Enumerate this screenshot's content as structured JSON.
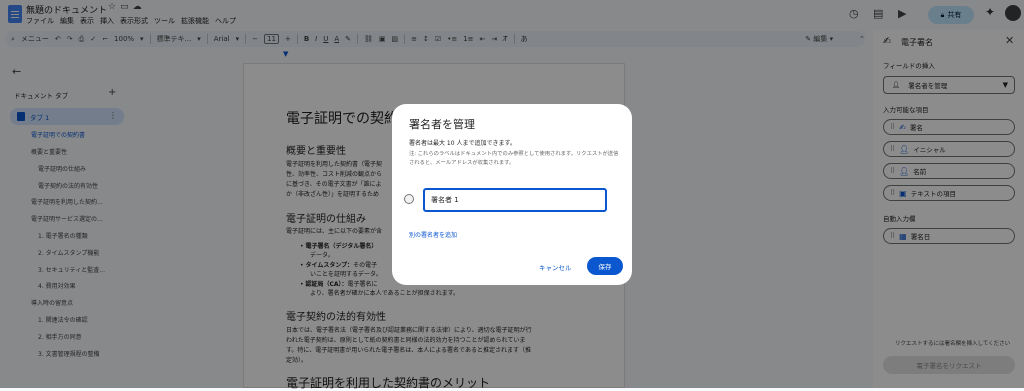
{
  "app": {
    "doc_title": "無題のドキュメント",
    "menus": [
      "ファイル",
      "編集",
      "表示",
      "挿入",
      "表示形式",
      "ツール",
      "拡張機能",
      "ヘルプ"
    ],
    "share_label": "共有"
  },
  "toolbar": {
    "menu_search": "メニュー",
    "zoom": "100%",
    "style": "標準テキ...",
    "font": "Arial",
    "font_size": "11",
    "bold": "B",
    "italic": "I",
    "underline": "U",
    "text_color": "A",
    "edit_mode": "編集"
  },
  "outline": {
    "heading": "ドキュメント タブ",
    "tab_label": "タブ 1",
    "items": [
      {
        "label": "電子証明での契約書",
        "active": true
      },
      {
        "label": "概要と重要性"
      },
      {
        "label": "電子証明の仕組み"
      },
      {
        "label": "電子契約の法的有効性"
      },
      {
        "label": "電子証明を利用した契約..."
      },
      {
        "label": "電子証明サービス選定の..."
      },
      {
        "label": "1. 電子署名の種類"
      },
      {
        "label": "2. タイムスタンプ機能"
      },
      {
        "label": "3. セキュリティと監査..."
      },
      {
        "label": "4. 費用対効果"
      },
      {
        "label": "導入時の留意点"
      },
      {
        "label": "1. 関連法令の確認"
      },
      {
        "label": "2. 相手方の同意"
      },
      {
        "label": "3. 文書管理規程の整備"
      }
    ]
  },
  "document": {
    "title": "電子証明での契約書",
    "section1_heading": "概要と重要性",
    "section1_lines": [
      "電子証明を利用した契約書（電子契",
      "性、効率性、コスト削減の観点から",
      "に基づき、その電子文書が「誰によ",
      "か（非改ざん性）」を証明するため"
    ],
    "section2_heading": "電子証明の仕組み",
    "section2_intro": "電子証明には、主に以下の要素が含",
    "bullets": [
      {
        "bold": "電子署名（デジタル署名）",
        "text": "",
        "cont": "データ。"
      },
      {
        "bold": "タイムスタンプ：",
        "text": "その電子",
        "cont": "いことを証明するデータ。"
      },
      {
        "bold": "認証局（CA）：",
        "text": "電子署名に",
        "cont": "より、署名者が確かに本人であることが担保されます。"
      }
    ],
    "section3_heading": "電子契約の法的有効性",
    "section3_lines": [
      "日本では、電子署名法（電子署名及び認証業務に関する法律）により、適切な電子証明が行",
      "われた電子契約は、原則として紙の契約書と同様の法的効力を持つことが認められていま",
      "す。特に、電子証明書が用いられた電子署名は、本人による署名であると推定されます（推",
      "定効）。"
    ],
    "section4_heading": "電子証明を利用した契約書のメリット"
  },
  "panel": {
    "title": "電子署名",
    "insert_label": "フィールドの挿入",
    "select_value": "署名者を管理",
    "fillable_label": "入力可能な項目",
    "fields": [
      "署名",
      "イニシャル",
      "名前",
      "テキストの項目"
    ],
    "auto_label": "自動入力欄",
    "auto_fields": [
      "署名日"
    ],
    "hint": "リクエストするには署名欄を挿入してください",
    "request_button": "電子署名をリクエスト"
  },
  "dialog": {
    "title": "署名者を管理",
    "subtitle": "署名者は最大 10 人まで追加できます。",
    "note": "注: これらのラベルはドキュメント内でのみ参照として使用されます。リクエストが送信されると、メールアドレスが収集されます。",
    "signer_value": "署名者 1",
    "add_link": "別の署名者を追加",
    "cancel": "キャンセル",
    "save": "保存"
  },
  "colors": {
    "accent": "#0b57d0",
    "share_bg": "#c2e7ff",
    "overlay": "#000000"
  }
}
